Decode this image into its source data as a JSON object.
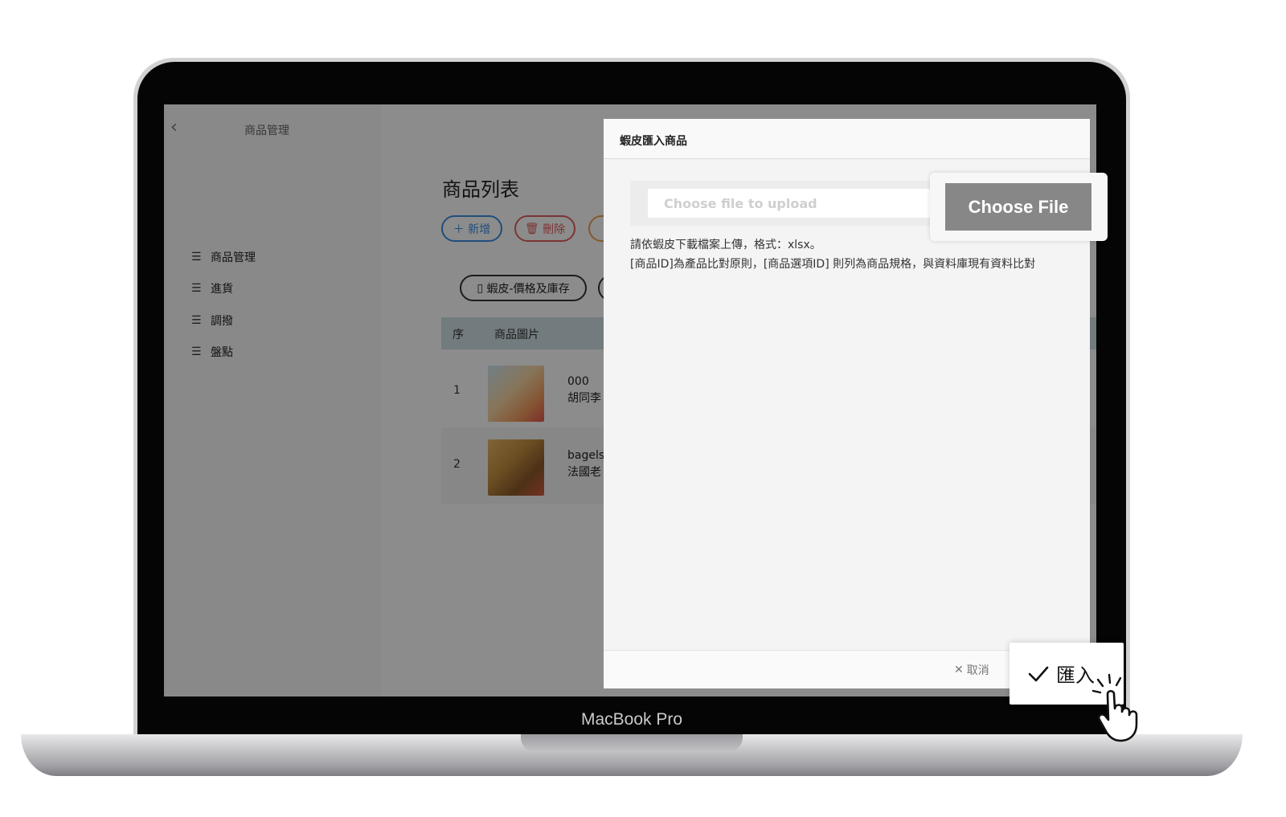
{
  "device": {
    "label": "MacBook Pro"
  },
  "sidebar": {
    "title": "商品管理",
    "items": [
      {
        "label": "商品管理",
        "icon": "list-icon"
      },
      {
        "label": "進貨",
        "icon": "list-icon"
      },
      {
        "label": "調撥",
        "icon": "list-icon"
      },
      {
        "label": "盤點",
        "icon": "list-icon"
      }
    ]
  },
  "main": {
    "title": "商品列表",
    "add_label": "新增",
    "delete_label": "刪除",
    "shopee_label": "蝦皮-價格及庫存",
    "table": {
      "headers": [
        "序",
        "商品圖片"
      ],
      "rows": [
        {
          "index": "1",
          "name_line1": "000",
          "name_line2": "胡同李"
        },
        {
          "index": "2",
          "name_line1": "bagels",
          "name_line2": "法國老"
        }
      ]
    }
  },
  "modal": {
    "title": "蝦皮匯入商品",
    "file_placeholder": "Choose file to upload",
    "choose_label": "Choose File",
    "help_line1": "請依蝦皮下載檔案上傳，格式：xlsx。",
    "help_line2": "[商品ID]為產品比對原則，[商品選項ID] 則列為商品規格，與資料庫現有資料比對",
    "cancel_label": "取消",
    "import_label": "匯入"
  },
  "colors": {
    "accent_blue": "#3b8de0",
    "danger_red": "#e26060",
    "choose_button": "#878787",
    "table_header": "#cfe1e6"
  }
}
